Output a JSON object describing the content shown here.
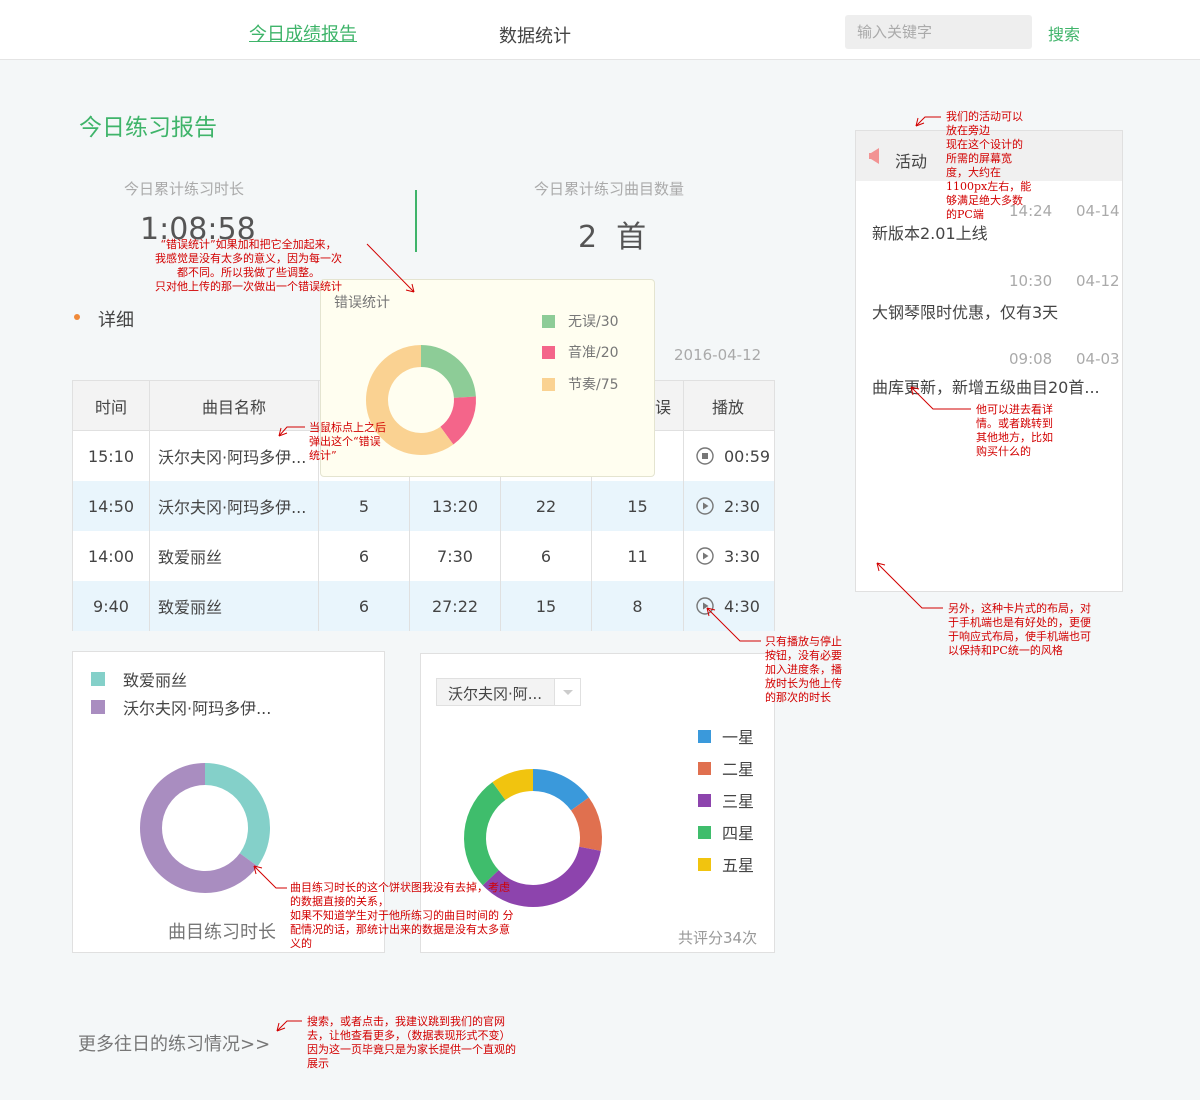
{
  "header": {
    "nav": [
      {
        "label": "今日成绩报告"
      },
      {
        "label": "数据统计"
      }
    ],
    "search": {
      "placeholder": "输入关键字",
      "button": "搜索"
    }
  },
  "page_title": "今日练习报告",
  "stats": [
    {
      "label": "今日累计练习时长",
      "value": "1:08:58"
    },
    {
      "label": "今日累计练习曲目数量",
      "value": "2  首"
    }
  ],
  "detail": {
    "label": "详细",
    "date": "2016-04-12"
  },
  "table": {
    "headers": [
      "时间",
      "曲目名称",
      "",
      "",
      "",
      "误",
      "播放"
    ],
    "rows": [
      {
        "time": "15:10",
        "name": "沃尔夫冈·阿玛多伊...",
        "c3": "",
        "c4": "",
        "c5": "",
        "c6": "",
        "play": "00:59",
        "state": "stop"
      },
      {
        "time": "14:50",
        "name": "沃尔夫冈·阿玛多伊...",
        "c3": "5",
        "c4": "13:20",
        "c5": "22",
        "c6": "15",
        "play": "2:30",
        "state": "play"
      },
      {
        "time": "14:00",
        "name": "致爱丽丝",
        "c3": "6",
        "c4": "7:30",
        "c5": "6",
        "c6": "11",
        "play": "3:30",
        "state": "play"
      },
      {
        "time": "9:40",
        "name": "致爱丽丝",
        "c3": "6",
        "c4": "27:22",
        "c5": "15",
        "c6": "8",
        "play": "4:30",
        "state": "play"
      }
    ]
  },
  "error_popup": {
    "title": "错误统计",
    "legend": [
      "无误/30",
      "音准/20",
      "节奏/75"
    ],
    "colors": [
      "#8dcc97",
      "#f4658a",
      "#fad292"
    ]
  },
  "chart_data": [
    {
      "type": "pie",
      "title": "错误统计",
      "categories": [
        "无误",
        "音准",
        "节奏"
      ],
      "values": [
        30,
        20,
        75
      ]
    },
    {
      "type": "pie",
      "title": "曲目练习时长",
      "categories": [
        "致爱丽丝",
        "沃尔夫冈·阿玛多伊..."
      ],
      "values": [
        35,
        65
      ],
      "colors": [
        "#84d0c9",
        "#a98dc0"
      ]
    },
    {
      "type": "pie",
      "title": "",
      "categories": [
        "一星",
        "二星",
        "三星",
        "四星",
        "五星"
      ],
      "values": [
        15,
        13,
        35,
        27,
        10
      ],
      "colors": [
        "#3a99db",
        "#e0704f",
        "#8d44ad",
        "#3fbd6c",
        "#f1c40f"
      ]
    }
  ],
  "duration_card": {
    "legend": [
      "致爱丽丝",
      "沃尔夫冈·阿玛多伊..."
    ],
    "caption": "曲目练习时长"
  },
  "rating_card": {
    "select_value": "沃尔夫冈·阿...",
    "legend": [
      "一星",
      "二星",
      "三星",
      "四星",
      "五星"
    ],
    "caption": "共评分34次"
  },
  "activity": {
    "title": "活动",
    "items": [
      {
        "time": "14:24",
        "date": "04-14",
        "text": "新版本2.01上线"
      },
      {
        "time": "10:30",
        "date": "04-12",
        "text": "大钢琴限时优惠，仅有3天"
      },
      {
        "time": "09:08",
        "date": "04-03",
        "text": "曲库更新，新增五级曲目20首..."
      }
    ]
  },
  "more_link": "更多往日的练习情况>>",
  "notes": {
    "error_stats": [
      "“错误统计”如果加和把它全加起来，",
      "我感觉是没有太多的意义，因为每一次",
      "都不同。所以我做了些调整。",
      "只对他上传的那一次做出一个错误统计"
    ],
    "hover": [
      "当鼠标点上之后",
      "弹出这个“错误",
      "统计”"
    ],
    "activity_side": [
      "我们的活动可以",
      "放在旁边",
      "现在这个设计的",
      "所需的屏幕宽",
      "度，大约在",
      "1100px左右，能",
      "够满足绝大多数",
      "的PC端"
    ],
    "activity_detail": [
      "他可以进去看详",
      "情。或者跳转到",
      "其他地方，比如",
      "购买什么的"
    ],
    "card_layout": [
      "另外，这种卡片式的布局，对",
      "于手机端也是有好处的，更便",
      "于响应式布局，使手机端也可",
      "以保持和PC统一的风格"
    ],
    "play": [
      "只有播放与停止",
      "按钮，没有必要",
      "加入进度条，播",
      "放时长为他上传",
      "的那次的时长"
    ],
    "pie": [
      "曲目练习时长的这个饼状图我没有去掉，考虑",
      "的数据直接的关系，",
      "如果不知道学生对于他所练习的曲目时间的 分",
      "配情况的话，那统计出来的数据是没有太多意",
      "义的"
    ],
    "more": [
      "搜索，或者点击，我建议跳到我们的官网",
      "去，让他查看更多，（数据表现形式不变）",
      "因为这一页毕竟只是为家长提供一个直观的",
      "展示"
    ]
  }
}
